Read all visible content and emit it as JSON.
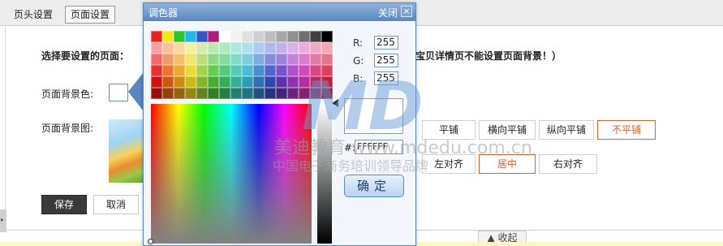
{
  "tabs": {
    "header_settings": "页头设置",
    "page_settings": "页面设置"
  },
  "form": {
    "select_page_label": "选择要设置的页面：",
    "note": "宝贝详情页不能设置页面背景！）",
    "bg_color_label": "页面背景色:",
    "bg_image_label": "页面背景图:",
    "repeat_options": [
      "平铺",
      "横向平铺",
      "纵向平铺",
      "不平铺"
    ],
    "repeat_selected": "不平铺",
    "align_options": [
      "左对齐",
      "居中",
      "右对齐"
    ],
    "align_selected": "居中",
    "save": "保存",
    "cancel": "取消",
    "collapse": "收起"
  },
  "color_dialog": {
    "title": "调色器",
    "close": "关闭",
    "r_label": "R:",
    "g_label": "G:",
    "b_label": "B:",
    "r": "255",
    "g": "255",
    "b": "255",
    "hex_label": "#:",
    "hex": "FFFFFF",
    "ok": "确定"
  },
  "watermark": {
    "logo": "MD",
    "line1": "美迪教育 www.mdedu.com.cn",
    "line2": "中国电子商务培训领导品牌"
  },
  "icons": {
    "close_x": "×",
    "collapse_arrow": "▲",
    "expand_arrow": "▸"
  },
  "colors": {
    "accent": "#d6602b",
    "dialog_border": "#5a86bf"
  }
}
